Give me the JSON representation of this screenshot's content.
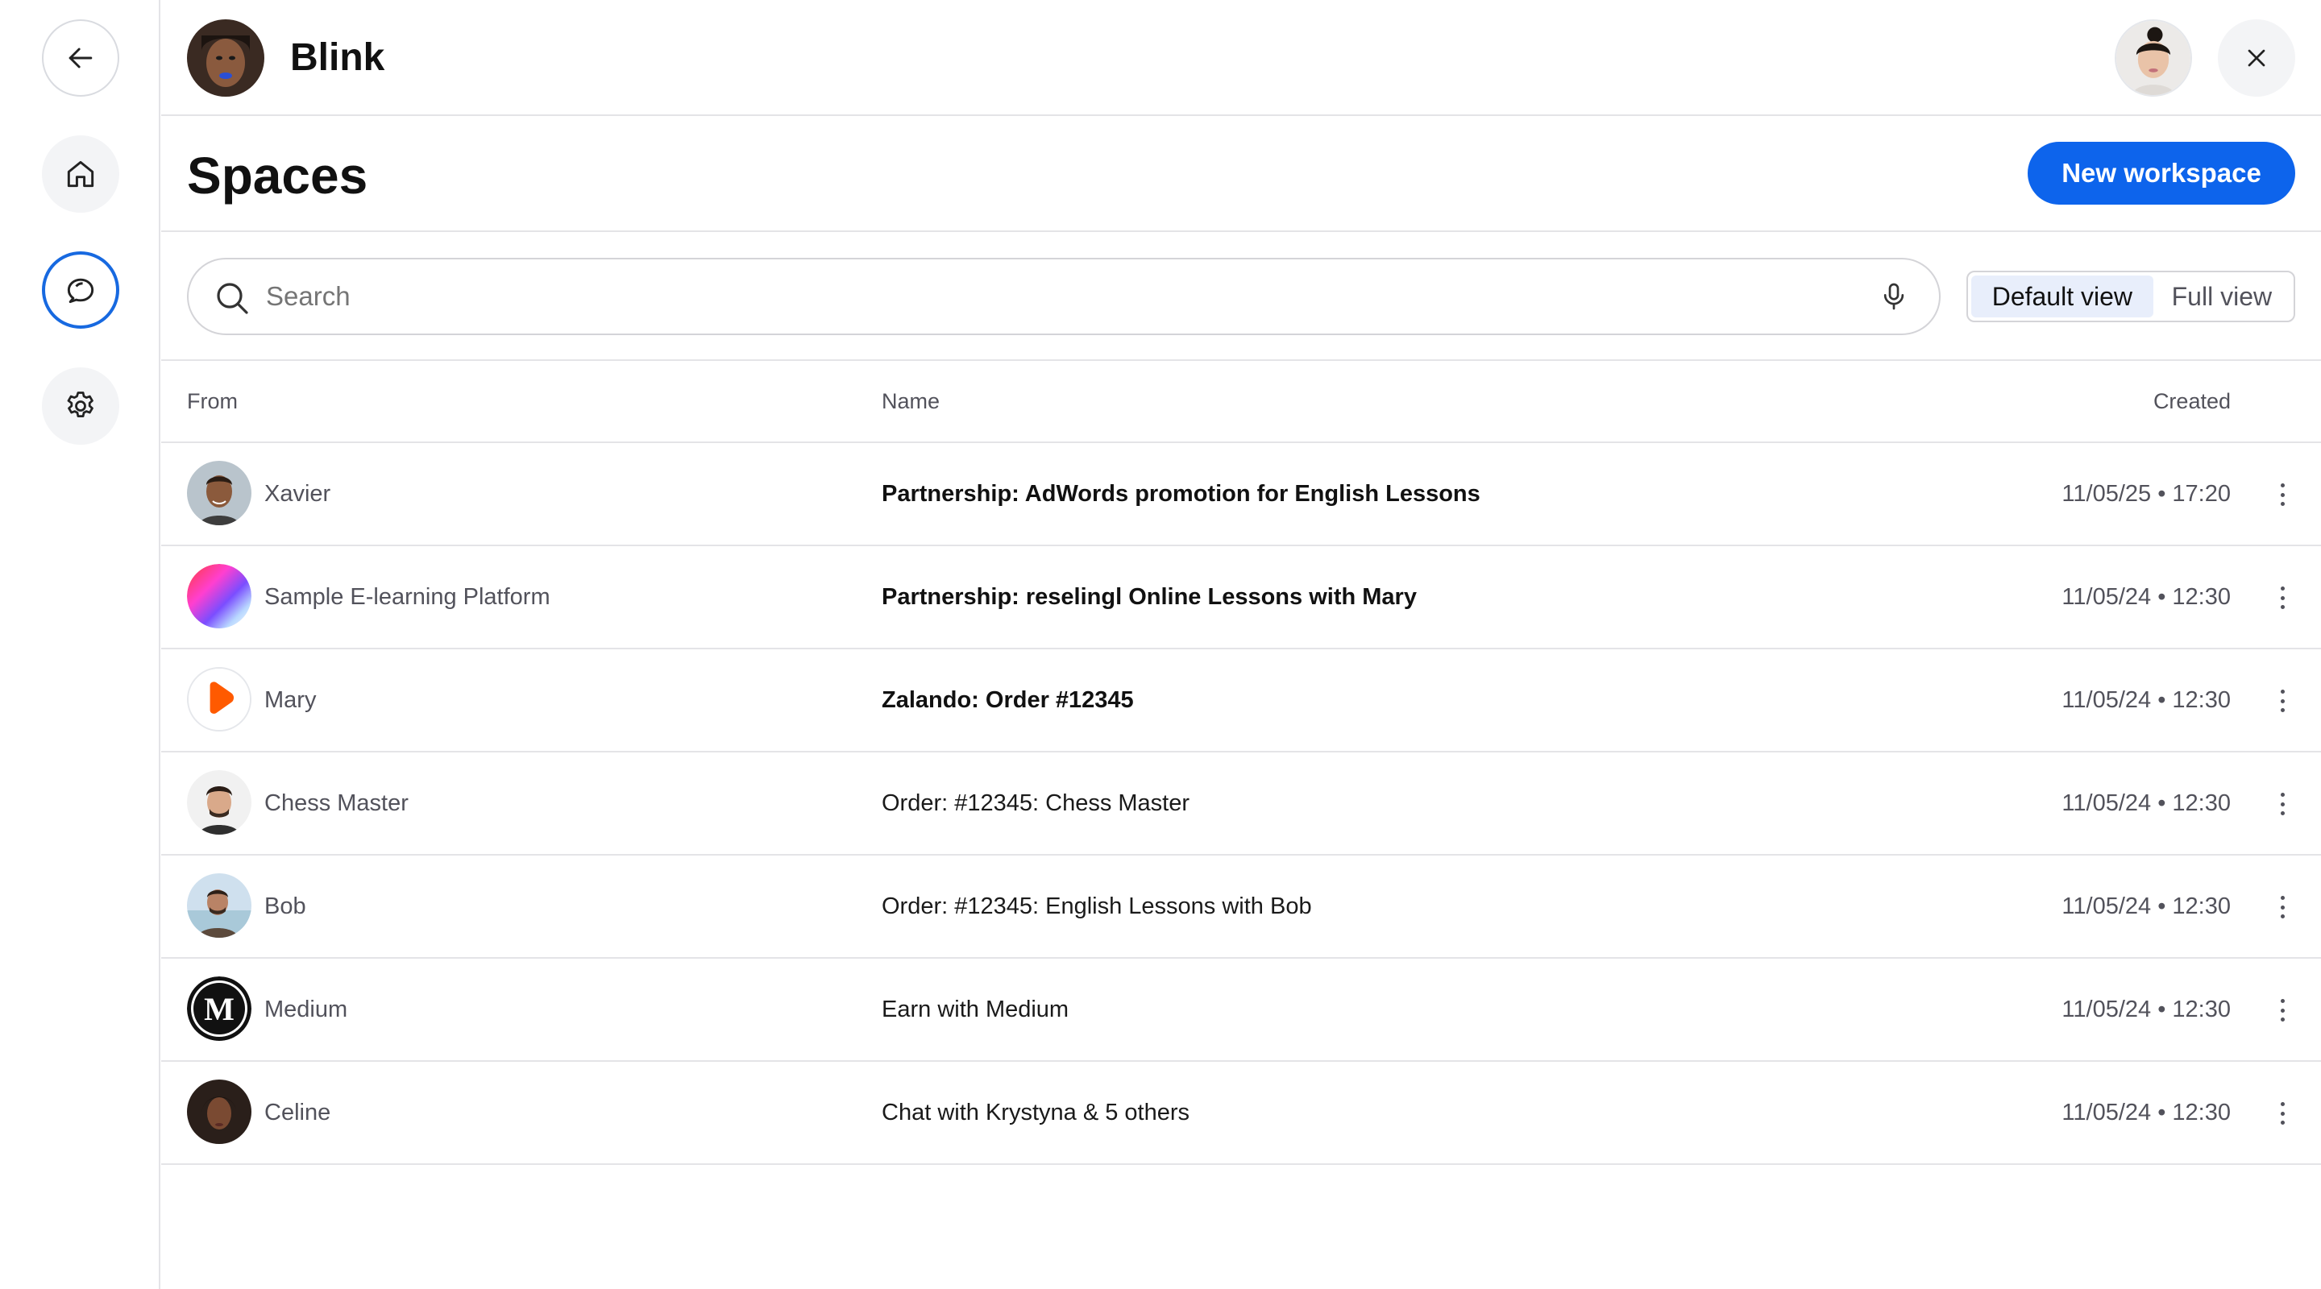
{
  "app": {
    "name": "Blink"
  },
  "page": {
    "title": "Spaces",
    "new_button": "New workspace"
  },
  "search": {
    "placeholder": "Search"
  },
  "view_toggle": {
    "default": "Default view",
    "full": "Full view",
    "selected": "Default view"
  },
  "table": {
    "headers": {
      "from": "From",
      "name": "Name",
      "created": "Created"
    },
    "rows": [
      {
        "from": "Xavier",
        "name": "Partnership: AdWords promotion for English Lessons",
        "created": "11/05/25 • 17:20",
        "unread": true
      },
      {
        "from": "Sample E-learning Platform",
        "name": "Partnership: reselingl Online Lessons with Mary",
        "created": "11/05/24 • 12:30",
        "unread": true
      },
      {
        "from": "Mary",
        "name": "Zalando: Order #12345",
        "created": "11/05/24 • 12:30",
        "unread": true
      },
      {
        "from": "Chess Master",
        "name": "Order: #12345: Chess Master",
        "created": "11/05/24 • 12:30",
        "unread": false
      },
      {
        "from": "Bob",
        "name": "Order: #12345: English Lessons with Bob",
        "created": "11/05/24 • 12:30",
        "unread": false
      },
      {
        "from": "Medium",
        "name": "Earn with Medium",
        "created": "11/05/24 • 12:30",
        "unread": false
      },
      {
        "from": "Celine",
        "name": "Chat with Krystyna & 5 others",
        "created": "11/05/24 • 12:30",
        "unread": false
      }
    ]
  },
  "colors": {
    "accent": "#0d64ec",
    "active_ring": "#1769e0",
    "border": "#e4e4e7"
  },
  "icons": {
    "rail": [
      "back-arrow-icon",
      "home-icon",
      "chat-bubbles-icon",
      "gear-icon"
    ],
    "search": "search-icon",
    "mic": "microphone-icon",
    "close": "close-icon",
    "row_menu": "more-vertical-icon"
  }
}
